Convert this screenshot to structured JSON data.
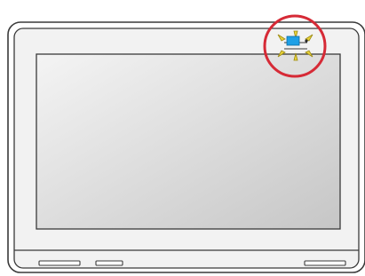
{
  "device": {
    "kind": "wall-mounted touch monitor",
    "screen_state": "blank",
    "indicator": {
      "state": "blinking",
      "led_color": "#1ea0e6",
      "highlight_ring_color": "#d62a36",
      "flash_ray_color": "#e8d23a"
    },
    "colors": {
      "outer_body": "#ffffff",
      "outline": "#3a3a3a",
      "bezel": "#f2f2f2",
      "screen_light": "#f4f4f4",
      "screen_dark": "#c6c6c6"
    }
  }
}
